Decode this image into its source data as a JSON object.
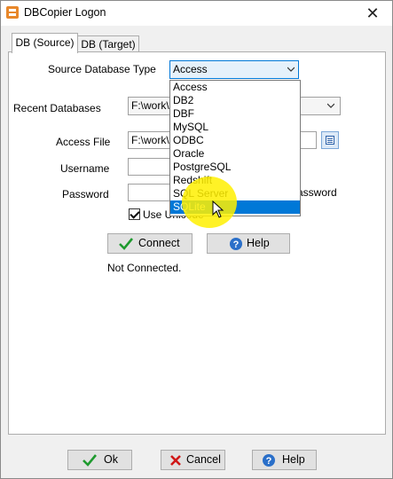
{
  "window": {
    "title": "DBCopier Logon",
    "close_glyph": "✕"
  },
  "tabs": [
    {
      "label": "DB (Source)"
    },
    {
      "label": "DB (Target)"
    }
  ],
  "form": {
    "source_type_label": "Source Database Type",
    "source_type_value": "Access",
    "recent_label": "Recent Databases",
    "recent_value": "F:\\work\\",
    "access_file_label": "Access File",
    "access_file_value": "F:\\work\\",
    "username_label": "Username",
    "username_value": "",
    "password_label": "Password",
    "password_value": "",
    "password_suffix": "assword",
    "unicode_label": "Use Unicode",
    "unicode_checked": true
  },
  "dropdown": {
    "options": [
      "Access",
      "DB2",
      "DBF",
      "MySQL",
      "ODBC",
      "Oracle",
      "PostgreSQL",
      "Redshift",
      "SQL Server",
      "SQLite"
    ],
    "selected": "SQLite"
  },
  "buttons": {
    "connect": "Connect",
    "help": "Help",
    "ok": "Ok",
    "cancel": "Cancel",
    "help_bottom": "Help"
  },
  "status": "Not Connected.",
  "icons": {
    "app": "dbcopier-app-icon",
    "check": "green-check-icon",
    "help": "help-question-icon",
    "cancel": "red-x-icon",
    "browse": "browse-file-icon",
    "cursor": "mouse-pointer-icon"
  },
  "colors": {
    "accent": "#0078d7",
    "highlight": "#fff000",
    "check_green": "#1e9a2e",
    "cancel_red": "#d01818",
    "help_blue": "#2a6fc9"
  }
}
